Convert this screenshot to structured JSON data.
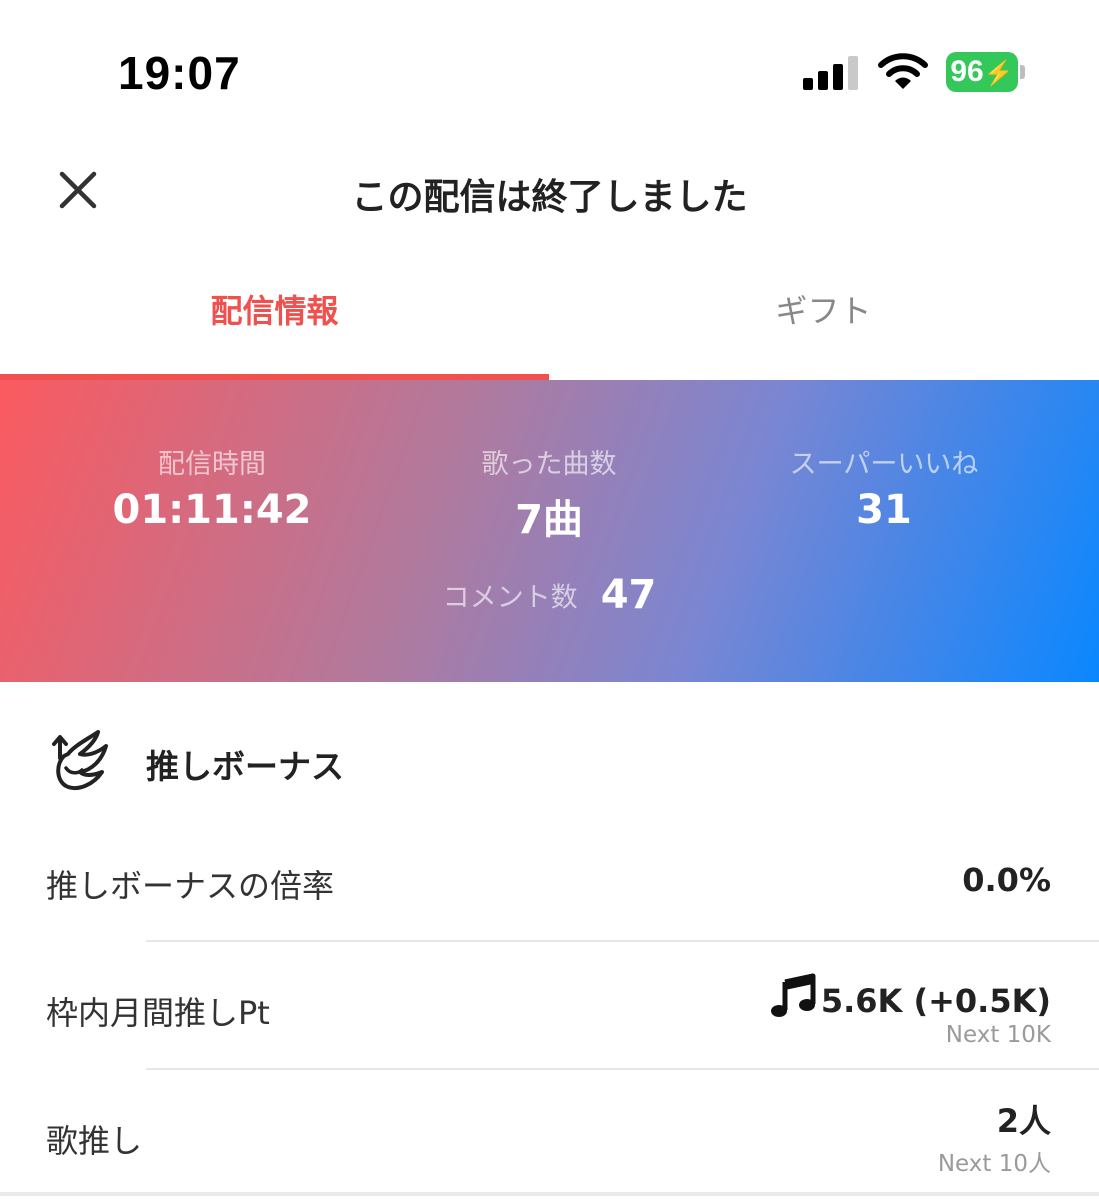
{
  "status_bar": {
    "time": "19:07",
    "battery": "96",
    "battery_color": "#34c759",
    "icons": [
      "cellular-signal-icon",
      "wifi-icon",
      "battery-charging-icon"
    ]
  },
  "header": {
    "title": "この配信は終了しました",
    "close_icon": "close-icon"
  },
  "tabs": [
    {
      "label": "配信情報",
      "active": true
    },
    {
      "label": "ギフト",
      "active": false
    }
  ],
  "accent_color": "#f0514e",
  "stats": {
    "duration": {
      "label": "配信時間",
      "value": "01:11:42"
    },
    "songs": {
      "label": "歌った曲数",
      "value": "7曲"
    },
    "super_likes": {
      "label": "スーパーいいね",
      "value": "31"
    },
    "comments": {
      "label": "コメント数",
      "value": "47"
    }
  },
  "bonus": {
    "title": "推しボーナス",
    "icon": "wing-icon",
    "rows": [
      {
        "label": "推しボーナスの倍率",
        "value": "0.0%"
      },
      {
        "label": "枠内月間推しPt",
        "value": "5.6K (+0.5K)",
        "sub": "Next 10K",
        "icon": "music-note-icon"
      },
      {
        "label": "歌推し",
        "value": "2人",
        "sub": "Next 10人"
      }
    ]
  }
}
